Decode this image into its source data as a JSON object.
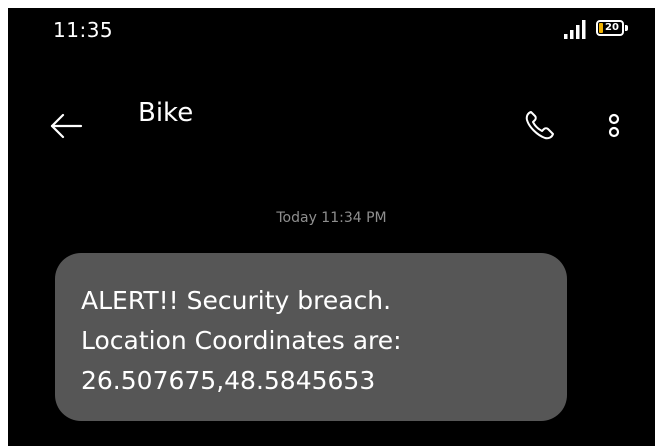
{
  "status_bar": {
    "time": "11:35",
    "battery_level": "20",
    "battery_percent": 20,
    "battery_color": "#f2b300"
  },
  "header": {
    "contact_name": "Bike",
    "icons": [
      "back-arrow-icon",
      "phone-icon",
      "more-vertical-icon"
    ]
  },
  "conversation": {
    "timestamp": "Today 11:34 PM",
    "messages": [
      {
        "direction": "incoming",
        "lines": [
          "ALERT!! Security breach.",
          "Location Coordinates are:",
          "26.507675,48.5845653"
        ]
      }
    ]
  },
  "colors": {
    "background": "#000000",
    "bubble": "#565656",
    "text": "#ffffff",
    "timestamp": "#8e8e8e"
  }
}
